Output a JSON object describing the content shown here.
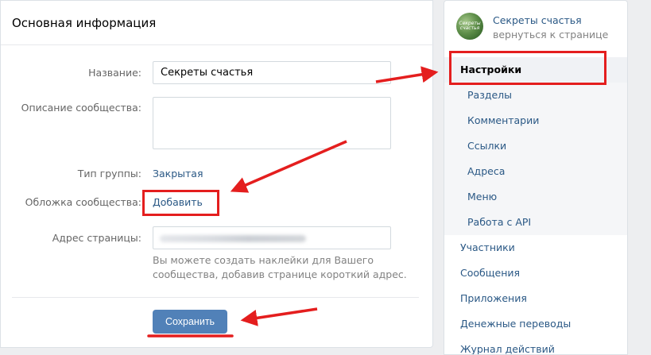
{
  "main": {
    "title": "Основная информация",
    "name_label": "Название:",
    "name_value": "Секреты счастья",
    "description_label": "Описание сообщества:",
    "description_value": "",
    "group_type_label": "Тип группы:",
    "group_type_value": "Закрытая",
    "cover_label": "Обложка сообщества:",
    "cover_link": "Добавить",
    "address_label": "Адрес страницы:",
    "address_hint": "Вы можете создать наклейки для Вашего сообщества, добавив странице короткий адрес.",
    "save_button": "Сохранить"
  },
  "sidebar": {
    "avatar_text": "Секреты счастья",
    "community_name": "Секреты счастья",
    "back_link": "вернуться к странице",
    "items": [
      {
        "label": "Настройки"
      },
      {
        "label": "Разделы"
      },
      {
        "label": "Комментарии"
      },
      {
        "label": "Ссылки"
      },
      {
        "label": "Адреса"
      },
      {
        "label": "Меню"
      },
      {
        "label": "Работа с API"
      },
      {
        "label": "Участники"
      },
      {
        "label": "Сообщения"
      },
      {
        "label": "Приложения"
      },
      {
        "label": "Денежные переводы"
      },
      {
        "label": "Журнал действий"
      }
    ]
  },
  "colors": {
    "link": "#2a5885",
    "button": "#5181b8",
    "annotation": "#e41e1e"
  }
}
